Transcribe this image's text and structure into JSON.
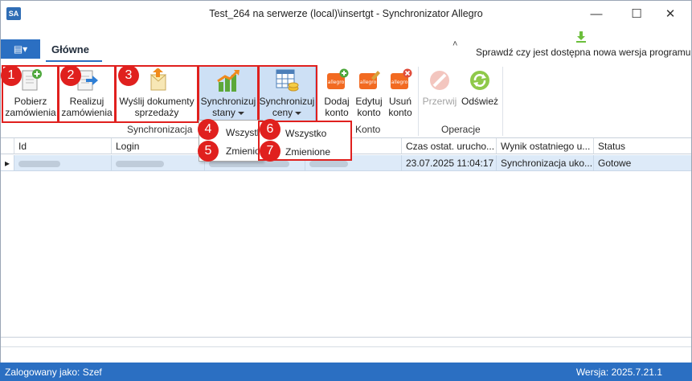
{
  "window": {
    "app_icon_text": "SA",
    "title": "Test_264 na serwerze (local)\\insertgt - Synchronizator Allegro",
    "minimize": "—",
    "maximize": "☐",
    "close": "✕"
  },
  "ribbon": {
    "file_menu_glyph": "▤▾",
    "active_tab": "Główne",
    "collapse_glyph": "˄",
    "update_text": "Sprawdź czy jest dostępna nowa wersja programu",
    "buttons": {
      "pobierz": {
        "line1": "Pobierz",
        "line2": "zamówienia"
      },
      "realizuj": {
        "line1": "Realizuj",
        "line2": "zamówienia"
      },
      "wyslij": {
        "line1": "Wyślij dokumenty",
        "line2": "sprzedaży"
      },
      "sync_stany": {
        "line1": "Synchronizuj",
        "line2": "stany"
      },
      "sync_ceny": {
        "line1": "Synchronizuj",
        "line2": "ceny"
      },
      "dodaj": {
        "line1": "Dodaj",
        "line2": "konto"
      },
      "edytuj": {
        "line1": "Edytuj",
        "line2": "konto"
      },
      "usun": {
        "line1": "Usuń",
        "line2": "konto"
      },
      "przerwij": {
        "line1": "Przerwij"
      },
      "odswiez": {
        "line1": "Odśwież"
      }
    },
    "groups": {
      "synchronizacja": "Synchronizacja",
      "konto": "Konto",
      "operacje": "Operacje"
    },
    "allegro_label": "allegro"
  },
  "badges": [
    "1",
    "2",
    "3",
    "4",
    "5",
    "6",
    "7"
  ],
  "menu_stany": {
    "items": [
      "Wszystko",
      "Zmienione"
    ]
  },
  "menu_ceny": {
    "items": [
      "Wszystko",
      "Zmienione"
    ]
  },
  "grid": {
    "columns": [
      "Id",
      "Login",
      "",
      "",
      "Czas ostat. urucho...",
      "Wynik ostatniego u...",
      "Status"
    ],
    "rows": [
      {
        "czas": "23.07.2025 11:04:17",
        "wynik": "Synchronizacja uko...",
        "status": "Gotowe"
      }
    ]
  },
  "statusbar": {
    "user": "Zalogowany jako: Szef",
    "version": "Wersja: 2025.7.21.1"
  },
  "colors": {
    "accent": "#2b6fc2",
    "highlight_box": "#e0201e",
    "selected_row": "#ddeaf8"
  }
}
